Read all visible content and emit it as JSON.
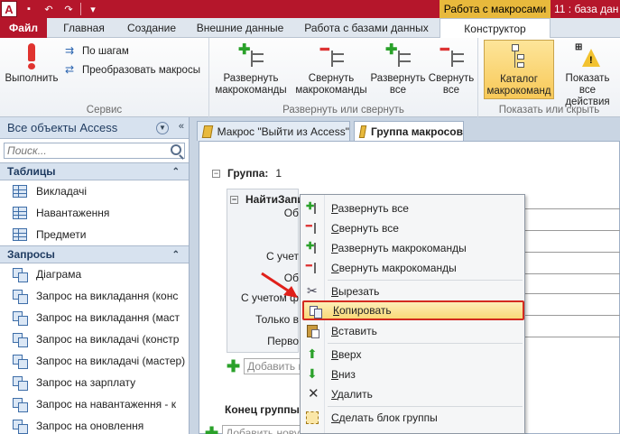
{
  "app": {
    "icon_letter": "A",
    "context_tab_title": "Работа с макросами",
    "window_title": "11 : база дан"
  },
  "tabs": [
    {
      "label": "Файл"
    },
    {
      "label": "Главная"
    },
    {
      "label": "Создание"
    },
    {
      "label": "Внешние данные"
    },
    {
      "label": "Работа с базами данных"
    },
    {
      "label": "Конструктор"
    }
  ],
  "ribbon": {
    "service": {
      "label": "Сервис",
      "run": "Выполнить",
      "step": "По шагам",
      "convert": "Преобразовать макросы"
    },
    "expand_collapse": {
      "label": "Развернуть или свернуть",
      "expand_actions": [
        "Развернуть",
        "макрокоманды"
      ],
      "collapse_actions": [
        "Свернуть",
        "макрокоманды"
      ],
      "expand_all": [
        "Развернуть",
        "все"
      ],
      "collapse_all": [
        "Свернуть",
        "все"
      ]
    },
    "show_hide": {
      "label": "Показать или скрыть",
      "catalog": [
        "Каталог",
        "макрокоманд"
      ],
      "show_all": [
        "Показать",
        "все действия"
      ]
    }
  },
  "nav": {
    "header": "Все объекты Access",
    "search_placeholder": "Поиск...",
    "tables_label": "Таблицы",
    "tables": [
      "Викладачі",
      "Навантаження",
      "Предмети"
    ],
    "queries_label": "Запросы",
    "queries": [
      "Діаграма",
      "Запрос на викладання (конс",
      "Запрос на викладання (маст",
      "Запрос на викладачі (констр",
      "Запрос на викладачі (мастер)",
      "Запрос на зарплату",
      "Запрос на навантаження - к",
      "Запрос на оновлення"
    ]
  },
  "doc_tabs": [
    {
      "label": "Макрос \"Выйти из Access\""
    },
    {
      "label": "Группа макросов"
    }
  ],
  "editor": {
    "group_label": "Группа:",
    "group_value": "1",
    "submacro_title": "НайтиЗапис",
    "arg_labels": [
      "Об",
      "С учет",
      "Об",
      "С учетом ф",
      "Только в",
      "Перво"
    ],
    "add_placeholder_inner": "Добавить н",
    "end_group": "Конец группы",
    "add_placeholder_outer": "Добавить нову"
  },
  "context_menu": [
    {
      "label": "Развернуть все",
      "icon": "expand-all-icon"
    },
    {
      "label": "Свернуть все",
      "icon": "collapse-all-icon"
    },
    {
      "label": "Развернуть макрокоманды",
      "icon": "expand-actions-icon"
    },
    {
      "label": "Свернуть макрокоманды",
      "icon": "collapse-actions-icon"
    },
    {
      "label": "Вырезать",
      "icon": "scissors-icon"
    },
    {
      "label": "Копировать",
      "icon": "copy-icon"
    },
    {
      "label": "Вставить",
      "icon": "paste-icon"
    },
    {
      "label": "Вверх",
      "icon": "arrow-up-icon"
    },
    {
      "label": "Вниз",
      "icon": "arrow-down-icon"
    },
    {
      "label": "Удалить",
      "icon": "delete-icon"
    },
    {
      "label": "Сделать блок группы",
      "icon": "make-group-icon"
    }
  ],
  "colors": {
    "brand": "#b5162b",
    "context_tab": "#e8b93c",
    "highlight_border": "#d32a1f"
  }
}
